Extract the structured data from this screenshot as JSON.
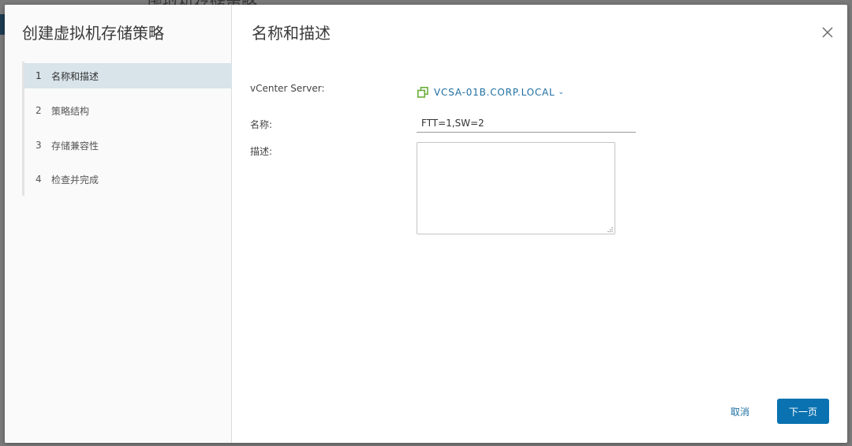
{
  "background": {
    "title": "虚拟机存储策略"
  },
  "wizard": {
    "title": "创建虚拟机存储策略",
    "steps": [
      {
        "number": "1",
        "label": "名称和描述",
        "active": true
      },
      {
        "number": "2",
        "label": "策略结构",
        "active": false
      },
      {
        "number": "3",
        "label": "存储兼容性",
        "active": false
      },
      {
        "number": "4",
        "label": "检查并完成",
        "active": false
      }
    ]
  },
  "page": {
    "title": "名称和描述",
    "close_icon": "close-icon"
  },
  "form": {
    "vcenter_label": "vCenter Server:",
    "vcenter_value": "VCSA-01B.CORP.LOCAL",
    "vcenter_icon": "vcenter-server-icon",
    "name_label": "名称:",
    "name_value": "FTT=1,SW=2",
    "description_label": "描述:",
    "description_value": ""
  },
  "footer": {
    "cancel_label": "取消",
    "next_label": "下一页"
  },
  "colors": {
    "accent": "#0a72b0",
    "link": "#1f6fa0",
    "active_step_bg": "#d8e3ea",
    "vcenter_icon": "#6aad3a"
  }
}
